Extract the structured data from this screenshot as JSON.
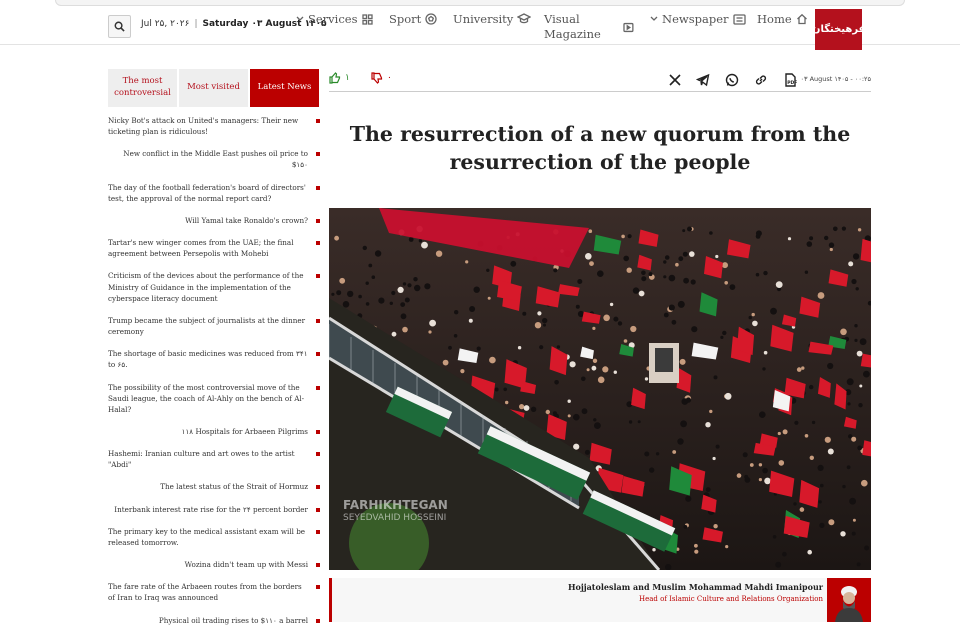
{
  "header": {
    "date_gregorian": "Jul ۲۵, ۲۰۲۶",
    "date_persian": "Saturday ۰۳ August ۱۴۰۵",
    "nav": [
      {
        "label": "Services",
        "icon": "grid-icon"
      },
      {
        "label": "Sport",
        "icon": "ball-icon"
      },
      {
        "label": "University",
        "icon": "graduation-cap-icon"
      },
      {
        "label": "Visual Magazine",
        "icon": "play-icon"
      },
      {
        "label": "Newspaper",
        "icon": "newspaper-icon"
      },
      {
        "label": "Home",
        "icon": "home-icon"
      }
    ],
    "logo_text": "فرهیختگان"
  },
  "sidebar": {
    "tabs": [
      "The most controversial",
      "Most visited",
      "Latest News"
    ],
    "active_tab": "Latest News",
    "items": [
      "Nicky Bot's attack on United's managers: Their new ticketing plan is ridiculous!",
      "New conflict in the Middle East pushes oil price to $۱۵۰",
      "The day of the football federation's board of directors' test, the approval of the normal report card?",
      "Will Yamal take Ronaldo's crown?",
      "Tartar's new winger comes from the UAE; the final agreement between Persepolis with Mohebi",
      "Criticism of the devices about the performance of the Ministry of Guidance in the implementation of the cyberspace literacy document",
      "Trump became the subject of journalists at the dinner ceremony",
      "The shortage of basic medicines was reduced from ۳۴۱ to ۶۵.",
      "The possibility of the most controversial move of the Saudi league, the coach of Al-Ahly on the bench of Al-Halal?",
      "۱۱۸ Hospitals for Arbaeen Pilgrims",
      "Hashemi: Iranian culture and art owes to the artist \"Abdi\"",
      "The latest status of the Strait of Hormuz",
      "Interbank interest rate rise for the ۲۴ percent border",
      "The primary key to the medical assistant exam will be released tomorrow.",
      "Wozina didn't team up with Messi",
      "The fare rate of the Arbaeen routes from the borders of Iran to Iraq was announced",
      "Physical oil trading rises to $۱۱۰ a barrel"
    ]
  },
  "article": {
    "likes": "۱",
    "dislikes": "۰",
    "date": "۰۳ August ۱۴۰۵ - ۰۰:۲۵",
    "title": "The resurrection of a new quorum from the resurrection of the people",
    "share_icons": [
      "x-icon",
      "telegram-icon",
      "whatsapp-icon",
      "link-icon",
      "pdf-icon"
    ],
    "photo_watermark": "FARHIKHTEGAN",
    "photo_credit": "SEYEDVAHID HOSSEINI",
    "caption_name": "Hojjatoleslam and Muslim Mohammad Mahdi Imanipour",
    "caption_role": "Head of Islamic Culture and Relations Organization"
  },
  "colors": {
    "brand": "#b4111d",
    "accent": "#b00000",
    "like": "#2a8a2a"
  }
}
